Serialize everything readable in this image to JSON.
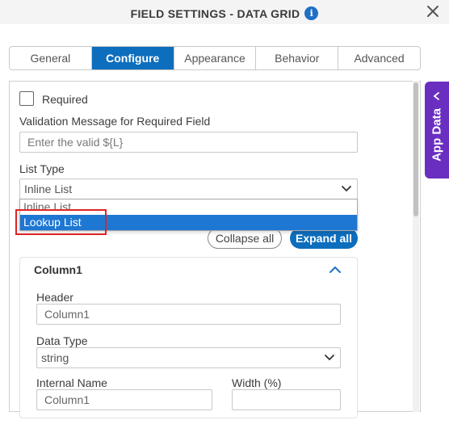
{
  "dialog": {
    "title": "FIELD SETTINGS - DATA GRID",
    "info_icon": "i",
    "close_icon": "close-icon"
  },
  "tabs": [
    {
      "label": "General",
      "active": false
    },
    {
      "label": "Configure",
      "active": true
    },
    {
      "label": "Appearance",
      "active": false
    },
    {
      "label": "Behavior",
      "active": false
    },
    {
      "label": "Advanced",
      "active": false
    }
  ],
  "form": {
    "required_label": "Required",
    "required_checked": false,
    "validation_label": "Validation Message for Required Field",
    "validation_placeholder": "Enter the valid ${L}",
    "list_type_label": "List Type",
    "list_type_value": "Inline List",
    "list_type_options": [
      "Inline List",
      "Lookup List"
    ],
    "list_type_highlighted": "Lookup List"
  },
  "actions": {
    "collapse_all": "Collapse all",
    "expand_all": "Expand all"
  },
  "column": {
    "title": "Column1",
    "header_label": "Header",
    "header_value": "Column1",
    "data_type_label": "Data Type",
    "data_type_value": "string",
    "internal_name_label": "Internal Name",
    "internal_name_value": "Column1",
    "width_label": "Width (%)",
    "width_value": ""
  },
  "side_panel": {
    "label": "App Data"
  },
  "colors": {
    "accent": "#0d6ebd",
    "side_panel": "#6a2fc0",
    "highlight_border": "#e02424",
    "dropdown_selected": "#1e77d3"
  }
}
